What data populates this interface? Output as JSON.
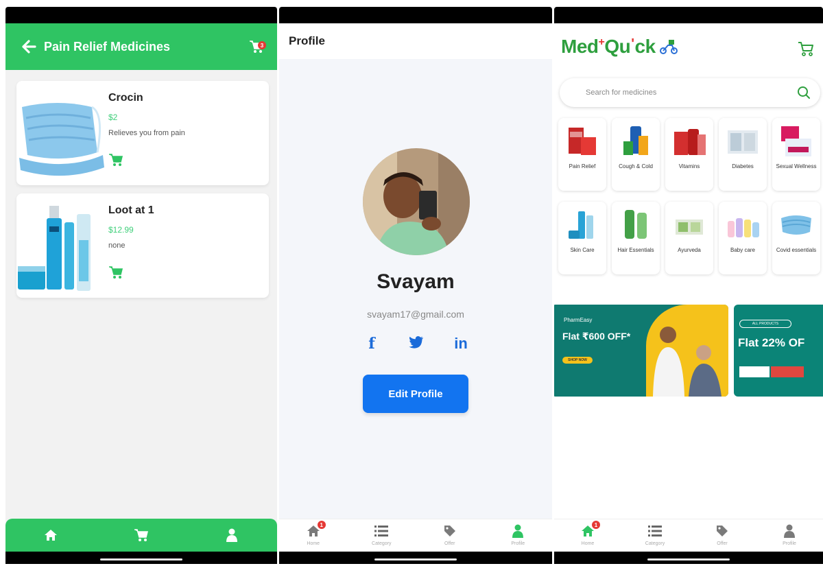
{
  "colors": {
    "green": "#2fc463",
    "blue": "#1274f0",
    "price": "#3fcf7a",
    "badge": "#e53935",
    "logo": "#2e9f3e"
  },
  "screen1": {
    "title": "Pain Relief Medicines",
    "cart_count": "3",
    "products": [
      {
        "name": "Crocin",
        "price": "$2",
        "description": "Relieves you from pain",
        "image": "face-mask"
      },
      {
        "name": "Loot at 1",
        "price": "$12.99",
        "description": "none",
        "image": "skincare-bottles"
      }
    ],
    "nav": [
      "home-icon",
      "cart-icon",
      "user-icon"
    ]
  },
  "screen2": {
    "title": "Profile",
    "name": "Svayam",
    "email": "svayam17@gmail.com",
    "social": {
      "facebook": "f",
      "twitter": "twitter-bird",
      "linkedin": "in"
    },
    "edit_button": "Edit Profile"
  },
  "screen3": {
    "logo_a": "Med",
    "logo_b": "Qu",
    "logo_c": "ck",
    "search_placeholder": "Search for medicines",
    "categories": [
      {
        "label": "Pain Relief"
      },
      {
        "label": "Cough & Cold"
      },
      {
        "label": "Vitamins"
      },
      {
        "label": "Diabetes"
      },
      {
        "label": "Sexual Wellness"
      },
      {
        "label": "Skin Care"
      },
      {
        "label": "Hair Essentials"
      },
      {
        "label": "Ayurveda"
      },
      {
        "label": "Baby care"
      },
      {
        "label": "Covid essentials"
      }
    ],
    "banner1": {
      "brand": "PharmEasy",
      "headline": "Flat ₹600 OFF*",
      "cta": "SHOP NOW"
    },
    "banner2": {
      "pill": "ALL PRODUCTS",
      "headline": "Flat 22% OF"
    }
  },
  "tabs": [
    {
      "label": "Home",
      "icon": "home-icon",
      "badge": "1"
    },
    {
      "label": "Category",
      "icon": "list-icon"
    },
    {
      "label": "Offer",
      "icon": "tag-icon"
    },
    {
      "label": "Profile",
      "icon": "user-icon"
    }
  ]
}
